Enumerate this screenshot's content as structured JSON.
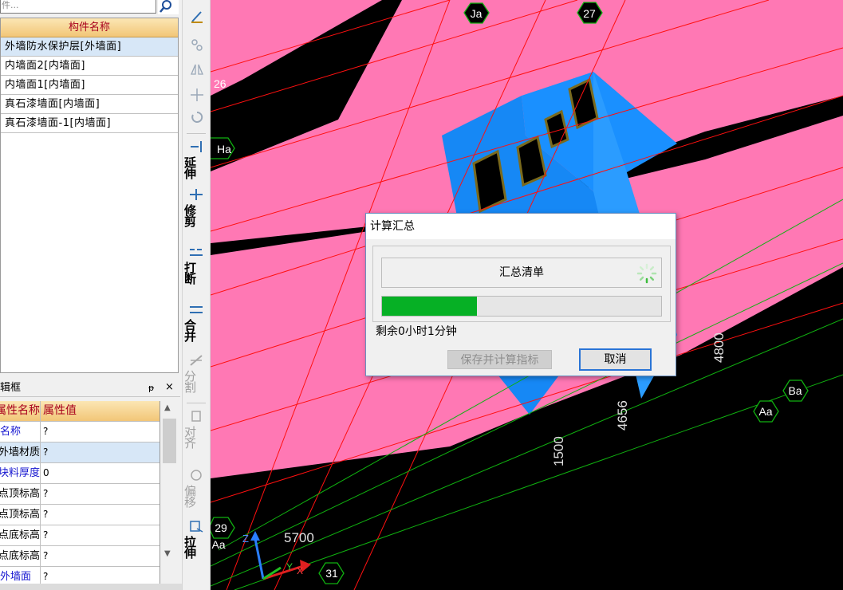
{
  "search": {
    "placeholder": "件..."
  },
  "component_list": {
    "header": "构件名称",
    "items": [
      {
        "label": "外墙防水保护层[外墙面]"
      },
      {
        "label": "内墙面2[内墙面]"
      },
      {
        "label": "内墙面1[内墙面]"
      },
      {
        "label": "真石漆墙面[内墙面]"
      },
      {
        "label": "真石漆墙面-1[内墙面]"
      }
    ]
  },
  "property_panel": {
    "title": "属性编辑框",
    "pin_glyph": "ᵽ",
    "close_glyph": "×",
    "col_name": "属性名称",
    "col_value": "属性值",
    "rows": [
      {
        "name": "名称",
        "value": "?"
      },
      {
        "name": "外墙材质",
        "value": "?"
      },
      {
        "name": "块料厚度(",
        "value": "0"
      },
      {
        "name": "起点顶标高",
        "value": "?"
      },
      {
        "name": "终点顶标高",
        "value": "?"
      },
      {
        "name": "起点底标高",
        "value": "?"
      },
      {
        "name": "终点底标高",
        "value": "?"
      },
      {
        "name": "外墙面",
        "value": "?"
      }
    ]
  },
  "toolbar": {
    "tools": [
      {
        "label": "延伸",
        "icon": "extend-icon"
      },
      {
        "label": "修剪",
        "icon": "trim-icon"
      },
      {
        "label": "打断",
        "icon": "break-icon"
      },
      {
        "label": "合并",
        "icon": "merge-icon"
      },
      {
        "label": "分割",
        "icon": "split-icon"
      },
      {
        "label": "对齐",
        "icon": "align-icon"
      },
      {
        "label": "偏移",
        "icon": "offset-icon"
      },
      {
        "label": "拉伸",
        "icon": "stretch-icon"
      }
    ]
  },
  "viewport": {
    "axis_labels": [
      "Ja",
      "27",
      "26",
      "Ha",
      "Ba",
      "Aa",
      "29",
      "Aa",
      "31"
    ],
    "dimensions": [
      "4800",
      "4656",
      "1500",
      "5700"
    ],
    "axis_triad": {
      "x": "X",
      "y": "Y",
      "z": "Z"
    },
    "colors": {
      "slab": "#ff78b4",
      "building": "#1e8fff",
      "background": "#000000"
    }
  },
  "dialog": {
    "title": "计算汇总",
    "task": "汇总清单",
    "progress": 0.34,
    "time_left": "剩余0小时1分钟",
    "save_button": "保存并计算指标",
    "cancel_button": "取消",
    "progress_color": "#06b025"
  }
}
